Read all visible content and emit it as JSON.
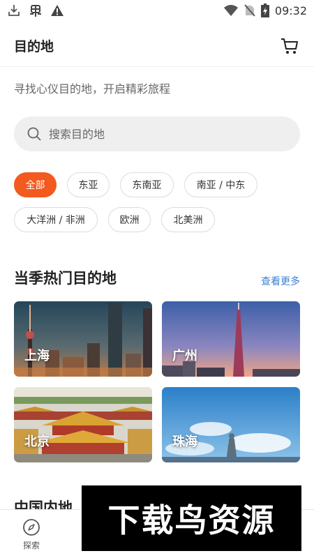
{
  "status_bar": {
    "time": "09:32",
    "icons": [
      "download-icon",
      "bug-icon",
      "warning-icon",
      "wifi-icon",
      "no-sim-icon",
      "battery-icon"
    ]
  },
  "header": {
    "title": "目的地",
    "cart_icon": "cart-icon"
  },
  "subtitle": "寻找心仪目的地，开启精彩旅程",
  "search": {
    "placeholder": "搜索目的地",
    "icon": "search-icon"
  },
  "filters": {
    "items": [
      {
        "label": "全部",
        "active": true
      },
      {
        "label": "东亚",
        "active": false
      },
      {
        "label": "东南亚",
        "active": false
      },
      {
        "label": "南亚 / 中东",
        "active": false
      },
      {
        "label": "大洋洲 / 非洲",
        "active": false
      },
      {
        "label": "欧洲",
        "active": false
      },
      {
        "label": "北美洲",
        "active": false
      }
    ],
    "active_color": "#f25a1f"
  },
  "hot_section": {
    "title": "当季热门目的地",
    "see_more": "查看更多",
    "link_color": "#3d7fd2",
    "cities": [
      {
        "name": "上海"
      },
      {
        "name": "广州"
      },
      {
        "name": "北京"
      },
      {
        "name": "珠海"
      }
    ]
  },
  "section2": {
    "title": "中国内地"
  },
  "bottom_nav": {
    "items": [
      {
        "label": "探索",
        "icon": "compass-icon"
      }
    ]
  },
  "watermark": {
    "text": "下载鸟资源"
  }
}
